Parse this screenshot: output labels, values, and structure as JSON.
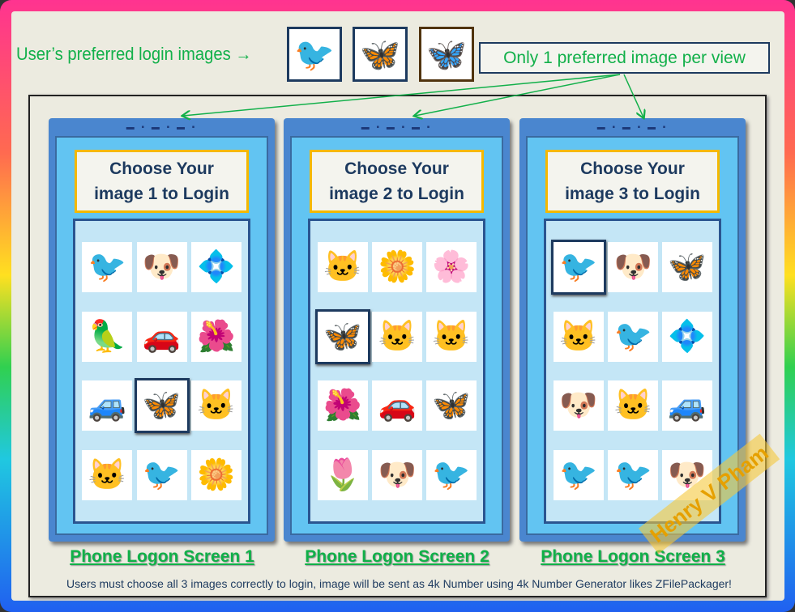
{
  "header": {
    "preferred_label": "User’s preferred login images →",
    "note": "Only 1 preferred image per view",
    "preferred_images": [
      {
        "icon": "lovebird-icon",
        "glyph": "🐦"
      },
      {
        "icon": "blue-butterfly-icon",
        "glyph": "🦋"
      },
      {
        "icon": "yellow-butterfly-icon",
        "glyph": "🦋"
      }
    ]
  },
  "phones": [
    {
      "title1": "Choose Your",
      "title2": "image 1 to Login",
      "caption": "Phone Logon Screen 1",
      "selected": 7,
      "images": [
        [
          "bird-icon",
          "🐦"
        ],
        [
          "dog-icon",
          "🐶"
        ],
        [
          "flower-icon",
          "💠"
        ],
        [
          "parrots-icon",
          "🦜"
        ],
        [
          "car-icon",
          "🚗"
        ],
        [
          "flower-icon",
          "🌺"
        ],
        [
          "car-icon",
          "🚙"
        ],
        [
          "yellow-butterfly-icon",
          "🦋"
        ],
        [
          "cat-icon",
          "🐱"
        ],
        [
          "kitten-icon",
          "🐱"
        ],
        [
          "cockatiel-icon",
          "🐦"
        ],
        [
          "flower-icon",
          "🌼"
        ]
      ]
    },
    {
      "title1": "Choose Your",
      "title2": "image 2 to Login",
      "caption": "Phone Logon Screen 2",
      "selected": 3,
      "images": [
        [
          "kitten-icon",
          "🐱"
        ],
        [
          "flower-icon",
          "🌼"
        ],
        [
          "flower-icon",
          "🌸"
        ],
        [
          "blue-butterfly-icon",
          "🦋"
        ],
        [
          "kitten-icon",
          "🐱"
        ],
        [
          "cat-icon",
          "🐱"
        ],
        [
          "flower-icon",
          "🌺"
        ],
        [
          "car-icon",
          "🚗"
        ],
        [
          "butterfly-icon",
          "🦋"
        ],
        [
          "flower-icon",
          "🌷"
        ],
        [
          "dog-icon",
          "🐶"
        ],
        [
          "cockatiel-icon",
          "🐦"
        ]
      ]
    },
    {
      "title1": "Choose Your",
      "title2": "image 3 to Login",
      "caption": "Phone Logon Screen 3",
      "selected": 0,
      "images": [
        [
          "lovebird-icon",
          "🐦"
        ],
        [
          "dog-icon",
          "🐶"
        ],
        [
          "yellow-butterfly-icon",
          "🦋"
        ],
        [
          "cat-icon",
          "🐱"
        ],
        [
          "bird-icon",
          "🐦"
        ],
        [
          "flower-icon",
          "💠"
        ],
        [
          "puppy-icon",
          "🐶"
        ],
        [
          "kitten-icon",
          "🐱"
        ],
        [
          "car-icon",
          "🚙"
        ],
        [
          "bluebird-icon",
          "🐦"
        ],
        [
          "bird-icon",
          "🐦"
        ],
        [
          "dog-icon",
          "🐶"
        ]
      ]
    }
  ],
  "footer": "Users must choose all 3 images correctly to login, image will be sent as 4k Number using 4k  Number Generator likes ZFilePackager!",
  "watermark": "Henry V Pham",
  "colors": {
    "accent_green": "#12b04a",
    "navy": "#1d3a5f",
    "phone_blue": "#4a86cf",
    "title_border": "#f5b800"
  }
}
